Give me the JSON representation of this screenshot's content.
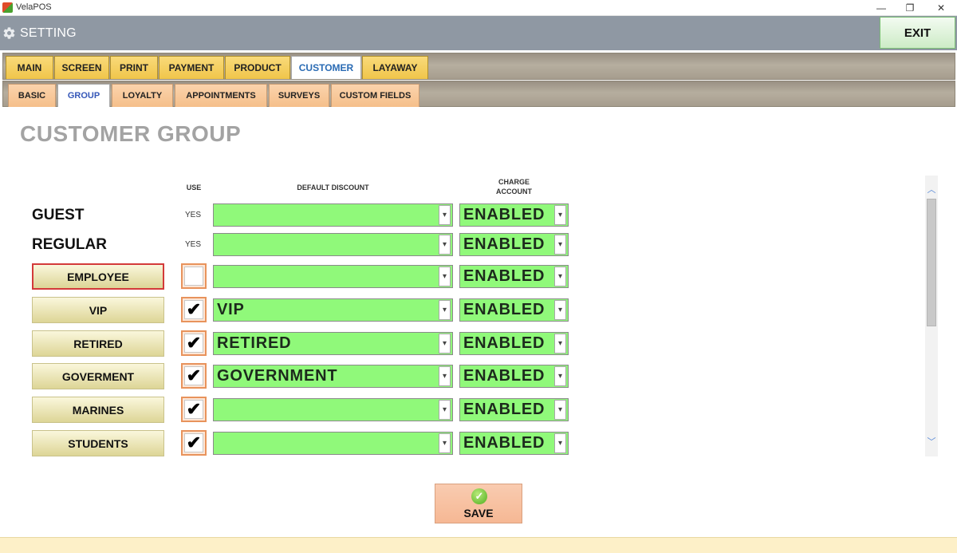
{
  "window": {
    "app_name": "VelaPOS",
    "minimize_glyph": "—",
    "restore_glyph": "❐",
    "close_glyph": "✕"
  },
  "header": {
    "title": "SETTING",
    "icon": "gear-icon",
    "exit_label": "EXIT"
  },
  "main_tabs": [
    {
      "label": "MAIN",
      "active": false
    },
    {
      "label": "SCREEN",
      "active": false
    },
    {
      "label": "PRINT",
      "active": false
    },
    {
      "label": "PAYMENT",
      "active": false
    },
    {
      "label": "PRODUCT",
      "active": false
    },
    {
      "label": "CUSTOMER",
      "active": true
    },
    {
      "label": "LAYAWAY",
      "active": false
    }
  ],
  "sub_tabs": [
    {
      "label": "BASIC",
      "active": false
    },
    {
      "label": "GROUP",
      "active": true
    },
    {
      "label": "LOYALTY",
      "active": false
    },
    {
      "label": "APPOINTMENTS",
      "active": false
    },
    {
      "label": "SURVEYS",
      "active": false
    },
    {
      "label": "CUSTOM FIELDS",
      "active": false
    }
  ],
  "section_title": "CUSTOMER GROUP",
  "columns": {
    "use": "USE",
    "default_discount": "DEFAULT DISCOUNT",
    "charge_account_line1": "CHARGE",
    "charge_account_line2": "ACCOUNT"
  },
  "fixed_groups": [
    {
      "name": "GUEST",
      "use": "YES",
      "discount": "",
      "charge": "ENABLED"
    },
    {
      "name": "REGULAR",
      "use": "YES",
      "discount": "",
      "charge": "ENABLED"
    }
  ],
  "custom_groups": [
    {
      "name": "EMPLOYEE",
      "checked": false,
      "selected": true,
      "discount": "",
      "charge": "ENABLED"
    },
    {
      "name": "VIP",
      "checked": true,
      "selected": false,
      "discount": "VIP",
      "charge": "ENABLED"
    },
    {
      "name": "RETIRED",
      "checked": true,
      "selected": false,
      "discount": "RETIRED",
      "charge": "ENABLED"
    },
    {
      "name": "GOVERMENT",
      "checked": true,
      "selected": false,
      "discount": "GOVERNMENT",
      "charge": "ENABLED"
    },
    {
      "name": "MARINES",
      "checked": true,
      "selected": false,
      "discount": "",
      "charge": "ENABLED"
    },
    {
      "name": "STUDENTS",
      "checked": true,
      "selected": false,
      "discount": "",
      "charge": "ENABLED"
    }
  ],
  "check_glyph": "✔",
  "dropdown_glyph": "▾",
  "scroll": {
    "up_glyph": "︿",
    "down_glyph": "﹀"
  },
  "save": {
    "label": "SAVE",
    "icon": "check-circle-icon",
    "icon_glyph": "✓"
  },
  "colors": {
    "combo_bg": "#90f97a",
    "header_bg": "#8f98a3",
    "tab_bg": "#f0c54a",
    "sub_tab_bg": "#f5bf8a",
    "selected_border": "#d33a3a"
  }
}
